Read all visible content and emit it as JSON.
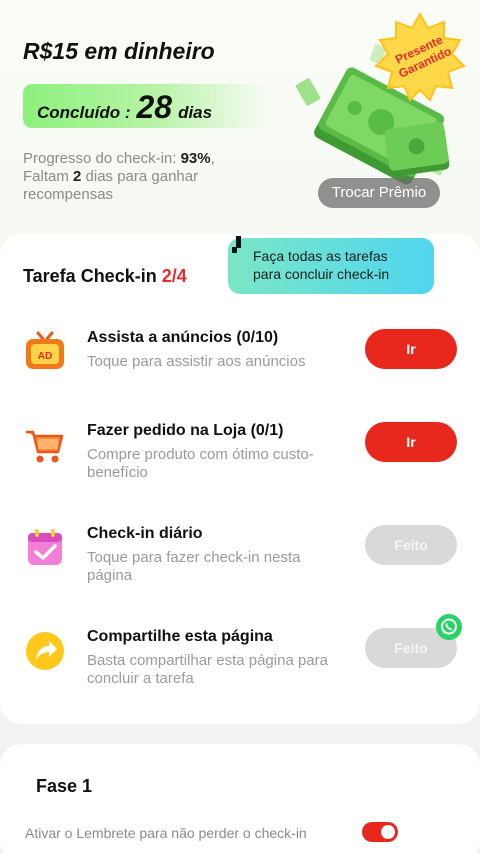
{
  "header": {
    "reward_title": "R$15 em dinheiro",
    "completed_label": "Concluído :",
    "completed_days": "28",
    "completed_unit": "dias",
    "progress_prefix": "Progresso do check-in: ",
    "progress_value": "93%",
    "progress_sep": ",",
    "remaining_prefix": "Faltam ",
    "remaining_value": "2",
    "remaining_suffix": " dias para ganhar recompensas",
    "badge_line1": "Presente",
    "badge_line2": "Garantido",
    "trocar_label": "Trocar Prêmio"
  },
  "tasks": {
    "header_label": "Tarefa Check-in ",
    "header_count": "2/4",
    "tooltip_line1": "Faça todas as tarefas",
    "tooltip_line2": "para concluir check-in",
    "items": [
      {
        "title": "Assista a anúncios  (0/10)",
        "desc": "Toque para assistir aos anúncios",
        "button": "Ir",
        "icon": "tv-ad-icon"
      },
      {
        "title": "Fazer pedido na Loja  (0/1)",
        "desc": "Compre produto com ótimo custo-benefício",
        "button": "Ir",
        "icon": "shopping-cart-icon"
      },
      {
        "title": "Check-in diário",
        "desc": "Toque para fazer check-in nesta página",
        "button": "Feito",
        "icon": "calendar-check-icon"
      },
      {
        "title": "Compartilhe esta página",
        "desc": "Basta compartilhar esta página para concluir a tarefa",
        "button": "Feito",
        "icon": "share-arrow-icon"
      }
    ]
  },
  "phase": {
    "title": "Fase 1",
    "reminder_label": "Ativar o Lembrete para não perder o check-in",
    "reminder_on": true
  },
  "colors": {
    "accent_red": "#e8281c",
    "pill_green": "#8ef07d",
    "tooltip_start": "#7be6c6",
    "tooltip_end": "#4fd6f0",
    "done_gray": "#d9d9d9"
  }
}
